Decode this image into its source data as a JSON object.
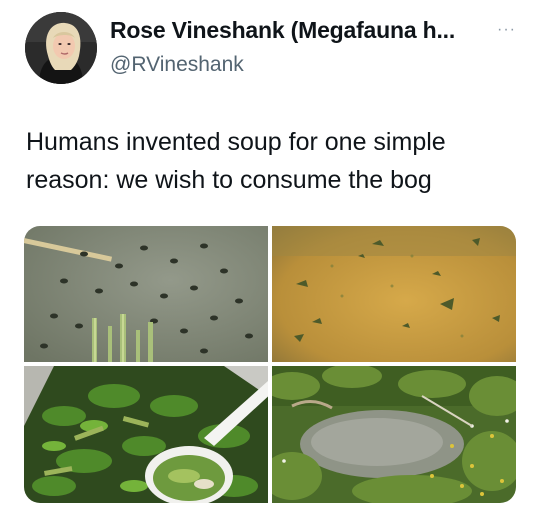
{
  "tweet": {
    "author": {
      "display_name": "Rose Vineshank (Megafauna h...",
      "handle": "@RVineshank",
      "avatar_icon": "profile-photo"
    },
    "more_icon": "ellipsis-icon",
    "text": "Humans invented soup for one simple reason: we wish to consume the bog",
    "media": [
      {
        "icon": "murky-pond-water-with-tadpoles"
      },
      {
        "icon": "yellow-broth-with-herbs"
      },
      {
        "icon": "green-vegetable-soup-with-ladle"
      },
      {
        "icon": "overgrown-bog-pond"
      }
    ]
  },
  "colors": {
    "text_primary": "#0f1419",
    "text_secondary": "#536471",
    "background": "#ffffff"
  }
}
